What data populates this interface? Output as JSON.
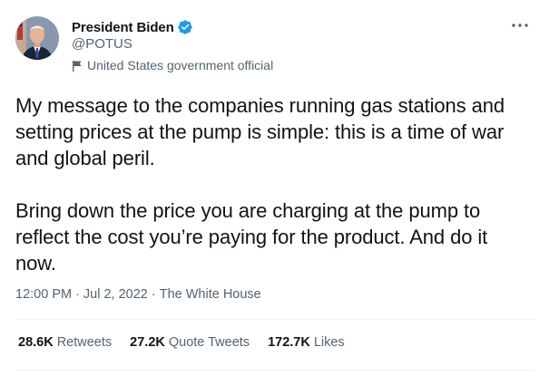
{
  "author": {
    "display_name": "President Biden",
    "handle": "@POTUS",
    "label": "United States government official"
  },
  "tweet": {
    "paragraphs": [
      "My message to the companies running gas stations and setting prices at the pump is simple: this is a time of war and global peril.",
      "Bring down the price you are charging at the pump to reflect the cost you’re paying for the product. And do it now."
    ],
    "time": "12:00 PM",
    "date": "Jul 2, 2022",
    "source": "The White House"
  },
  "stats": {
    "retweets_count": "28.6K",
    "retweets_label": "Retweets",
    "quotes_count": "27.2K",
    "quotes_label": "Quote Tweets",
    "likes_count": "172.7K",
    "likes_label": "Likes"
  },
  "colors": {
    "verified": "#1d9bf0",
    "secondary_text": "#536471",
    "primary_text": "#0f1419"
  },
  "icons": {
    "verified": "verified-badge-icon",
    "label": "flag-icon",
    "more": "more-dots-icon"
  }
}
